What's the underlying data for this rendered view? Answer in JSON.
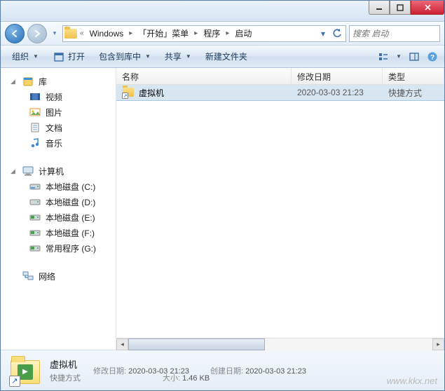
{
  "breadcrumb": {
    "prefix_tooltip": "导航历史",
    "items": [
      "Windows",
      "「开始」菜单",
      "程序",
      "启动"
    ]
  },
  "search": {
    "placeholder": "搜索 启动"
  },
  "toolbar": {
    "organize": "组织",
    "open": "打开",
    "include": "包含到库中",
    "share": "共享",
    "new_folder": "新建文件夹"
  },
  "sidebar": {
    "libraries": {
      "label": "库",
      "items": [
        "视频",
        "图片",
        "文档",
        "音乐"
      ]
    },
    "computer": {
      "label": "计算机",
      "items": [
        "本地磁盘 (C:)",
        "本地磁盘 (D:)",
        "本地磁盘 (E:)",
        "本地磁盘 (F:)",
        "常用程序 (G:)"
      ]
    },
    "network": {
      "label": "网络"
    }
  },
  "columns": {
    "name": "名称",
    "modified": "修改日期",
    "type": "类型"
  },
  "files": [
    {
      "name": "虚拟机",
      "modified": "2020-03-03 21:23",
      "type": "快捷方式"
    }
  ],
  "details": {
    "name": "虚拟机",
    "type": "快捷方式",
    "modified_label": "修改日期:",
    "modified": "2020-03-03 21:23",
    "created_label": "创建日期:",
    "created": "2020-03-03 21:23",
    "size_label": "大小:",
    "size": "1.46 KB"
  },
  "watermark": "www.kkx.net"
}
